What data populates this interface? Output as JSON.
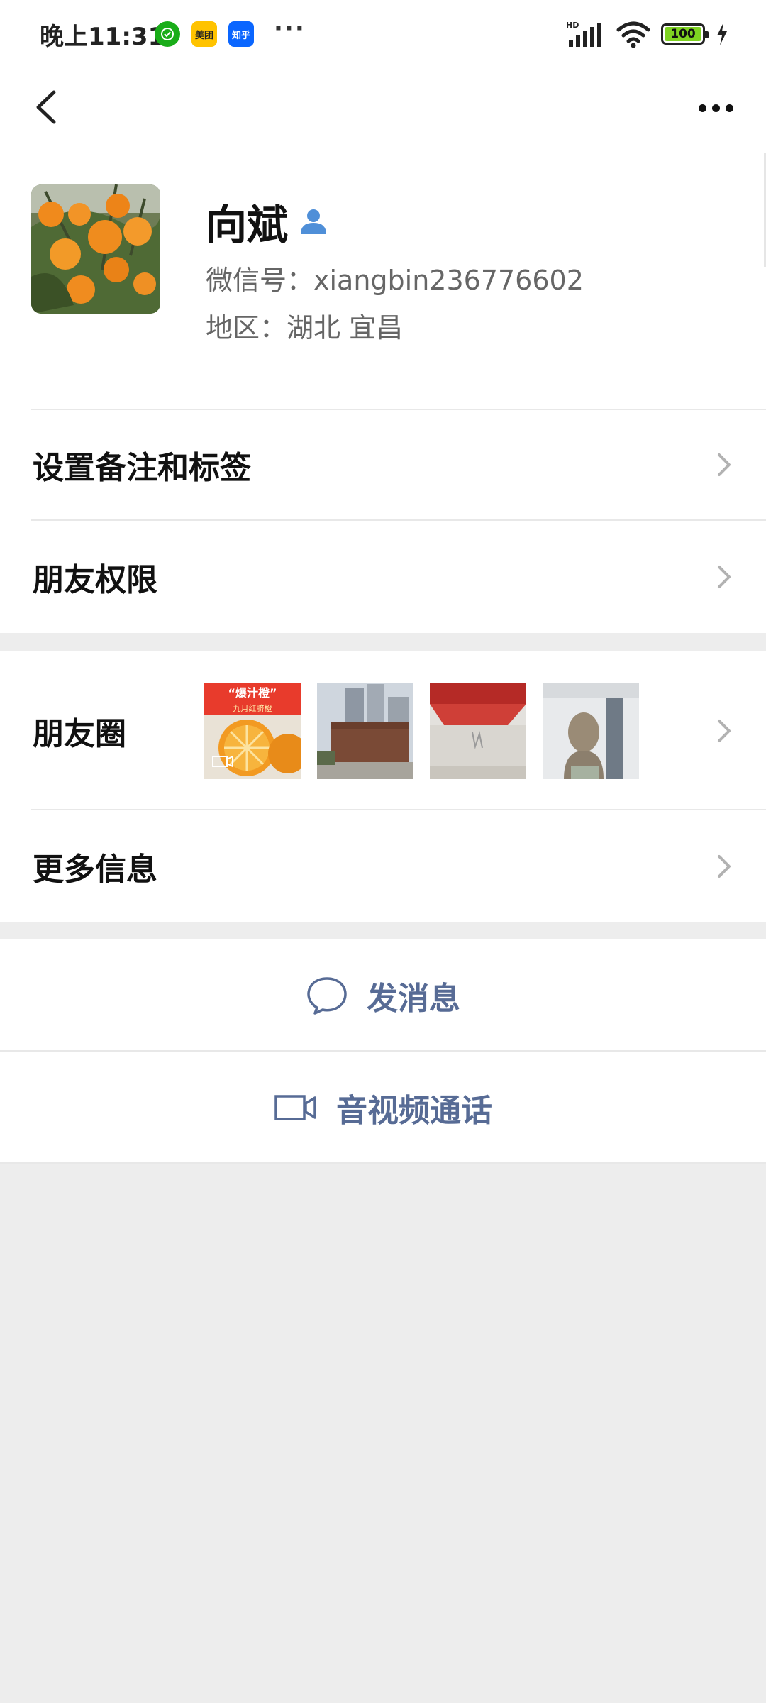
{
  "status_bar": {
    "time": "晚上11:31",
    "apps": [
      {
        "name": "app-green",
        "label": "",
        "color": "#1aad19"
      },
      {
        "name": "meituan",
        "label": "美团",
        "color": "#ffc300"
      },
      {
        "name": "zhihu",
        "label": "知乎",
        "color": "#0a66ff"
      }
    ],
    "more": "···",
    "network": "HD",
    "battery": "100"
  },
  "profile": {
    "name": "向斌",
    "wechat_id": "微信号：xiangbin236776602",
    "region": "地区：湖北  宜昌"
  },
  "menu": {
    "remark_tags": "设置备注和标签",
    "friend_permissions": "朋友权限",
    "moments": "朋友圈",
    "more_info": "更多信息"
  },
  "moments_thumbs": {
    "thumb1_title": "“爆汁橙”",
    "thumb1_sub": "九月红脐橙"
  },
  "actions": {
    "send_message": "发消息",
    "video_call": "音视频通话"
  },
  "colors": {
    "link_blue": "#576b95",
    "background": "#ededed",
    "divider": "#e8e8e8"
  }
}
